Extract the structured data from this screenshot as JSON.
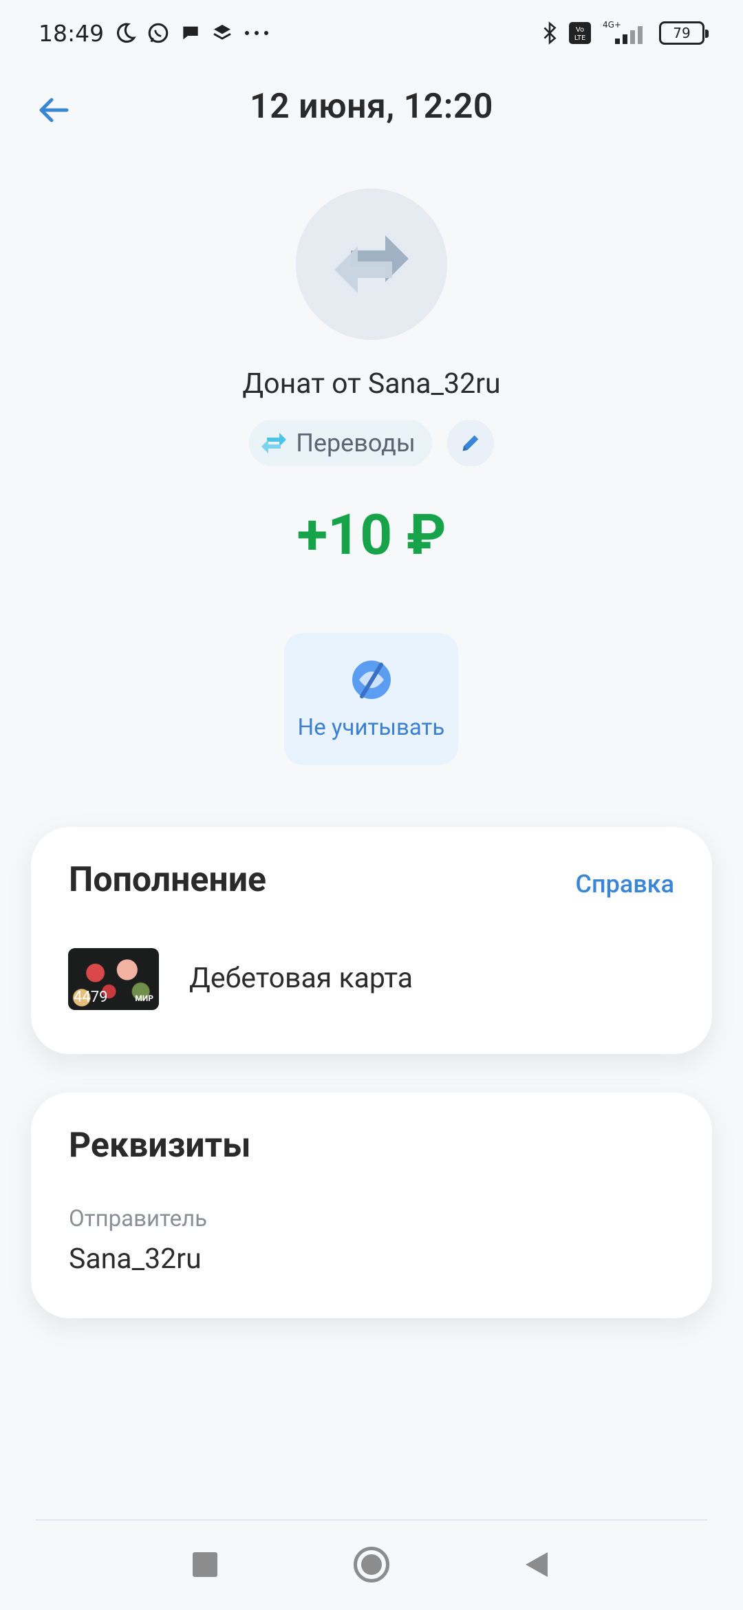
{
  "status_bar": {
    "time": "18:49",
    "battery": "79",
    "network": "4G+",
    "volte": "Vo LTE",
    "icons": [
      "moon-icon",
      "whatsapp-icon",
      "chat-icon",
      "layers-icon",
      "more-icon",
      "bluetooth-icon",
      "volte-icon",
      "signal-icon",
      "battery-icon"
    ]
  },
  "header": {
    "title": "12 июня, 12:20"
  },
  "operation": {
    "icon": "transfer-arrows-icon",
    "title": "Донат от Sana_32ru",
    "category": "Переводы",
    "amount": "+10 ₽",
    "exclude_label": "Не учитывать"
  },
  "refill_card": {
    "title": "Пополнение",
    "help_link": "Справка",
    "card_last4": "4479",
    "card_brand": "МИР",
    "card_name": "Дебетовая карта"
  },
  "requisites_card": {
    "title": "Реквизиты",
    "sender_label": "Отправитель",
    "sender_value": "Sana_32ru"
  },
  "colors": {
    "accent": "#3a86d6",
    "amount_positive": "#16a34a",
    "background": "#f7f8fa"
  }
}
